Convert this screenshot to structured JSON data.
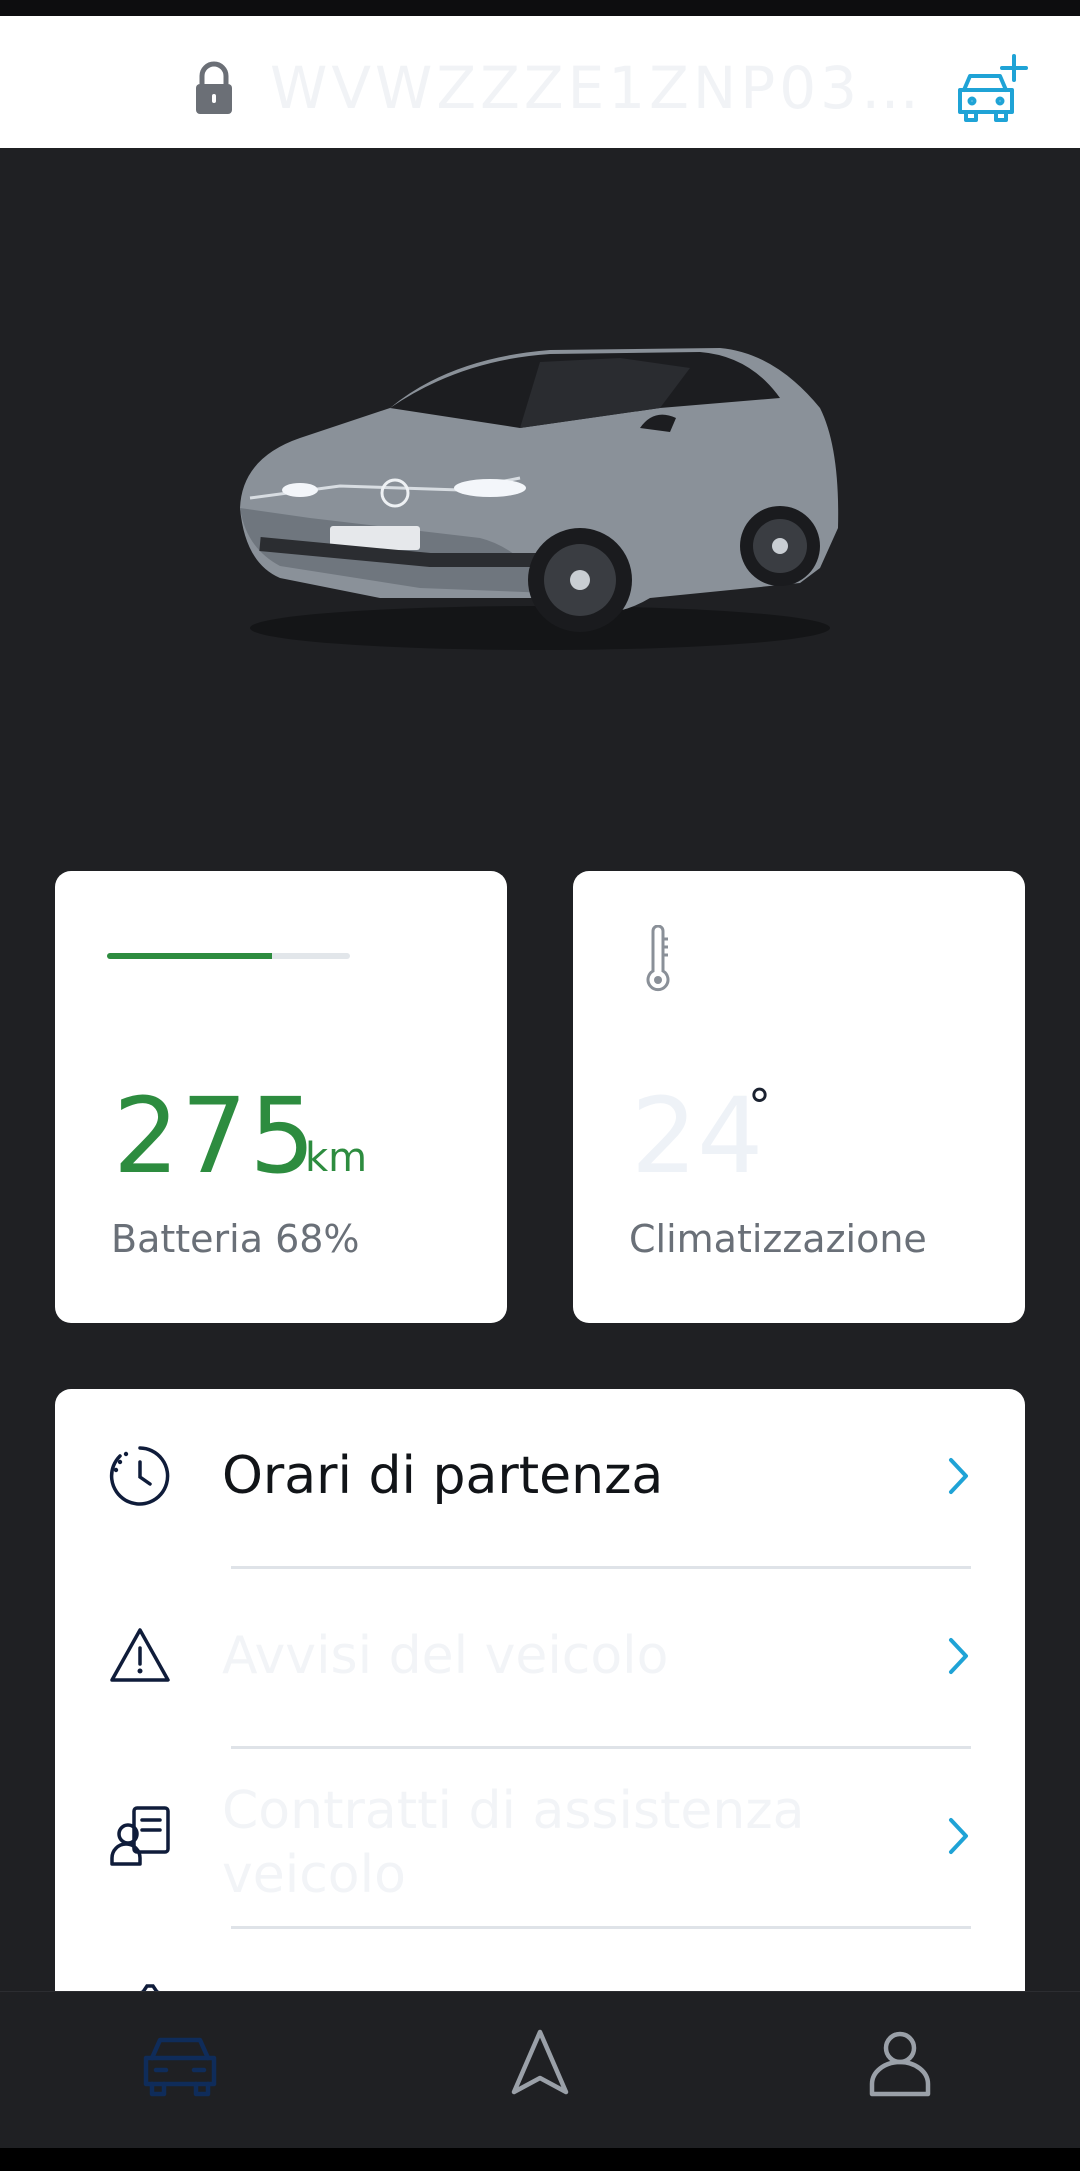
{
  "header": {
    "vin": "WVWZZZE1ZNP03…",
    "lock_icon": "lock-icon",
    "add_car_icon": "car-add-icon"
  },
  "vehicle_image": "vw-id3-grey",
  "battery_card": {
    "range_value": "275",
    "range_unit": "km",
    "label": "Batteria 68%",
    "charge_level": 0.68,
    "accent_color": "#2d8c3f"
  },
  "climate_card": {
    "icon": "thermometer-icon",
    "temperature": "24",
    "degree_symbol": "°",
    "label": "Climatizzazione"
  },
  "menu": {
    "items": [
      {
        "icon": "clock-icon",
        "label": "Orari di partenza"
      },
      {
        "icon": "warning-icon",
        "label": "Avvisi del veicolo"
      },
      {
        "icon": "service-contract-icon",
        "label": "Contratti di assistenza veicolo"
      }
    ]
  },
  "bottom_nav": {
    "items": [
      {
        "icon": "car-icon",
        "active": true
      },
      {
        "icon": "navigation-icon",
        "active": false
      },
      {
        "icon": "profile-icon",
        "active": false
      }
    ]
  },
  "colors": {
    "background": "#1f2023",
    "link_accent": "#1fa3d6",
    "active_nav": "#0f2c5a"
  }
}
